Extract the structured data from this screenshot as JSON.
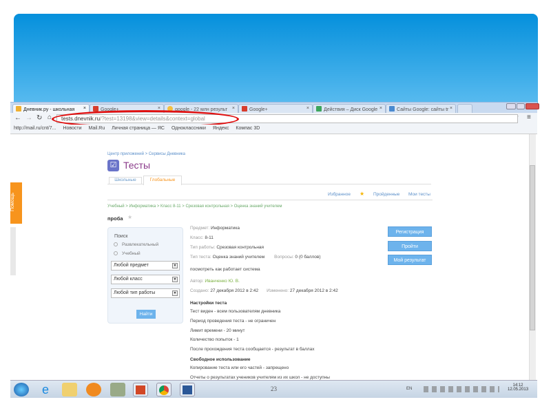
{
  "browser": {
    "tabs": [
      {
        "label": "Дневник.ру - школьная"
      },
      {
        "label": "Google+"
      },
      {
        "label": "google - 22 млн результ"
      },
      {
        "label": "Google+"
      },
      {
        "label": "Действия – Диск Google"
      },
      {
        "label": "Сайты Google: сайты tr"
      }
    ],
    "tab_close": "×",
    "url_host": "tests.dnevnik.ru",
    "url_path": "/?test=13198&view=details&context=global",
    "bookmarks": [
      "http://mail.ru/cnt/7...",
      "Новости",
      "Mail.Ru",
      "Личная страница — ЯС",
      "Одноклассники",
      "Яндекс",
      "Компас 3D"
    ]
  },
  "help_tab": "Помощь",
  "page": {
    "breadcrumb_top": "Центр приложений > Сервисы Дневника",
    "title": "Тесты",
    "tabs": [
      "Школьные",
      "Глобальные"
    ],
    "nav": {
      "favorites": "Избранное",
      "passed": "Пройденные",
      "my_tests": "Мои тесты"
    },
    "breadcrumb": "Учебный > Информатика > Класс 8-11 > Срезовая контрольная > Оценка знаний учителем",
    "test_name": "проба",
    "search": {
      "title": "Поиск",
      "radios": [
        "Развлекательный",
        "Учебный"
      ],
      "selects": [
        "Любой предмет",
        "Любой класс",
        "Любой тип работы"
      ],
      "button": "Найти"
    },
    "details": [
      {
        "label": "Предмет:",
        "value": "Информатика"
      },
      {
        "label": "Класс:",
        "value": "8-11"
      },
      {
        "label": "Тип работы:",
        "value": "Срезовая контрольная"
      }
    ],
    "test_type_label": "Тип теста:",
    "test_type": "Оценка знаний учителем",
    "questions_label": "Вопросы:",
    "questions": "0 (0 баллов)",
    "description": "посмотреть как работает система",
    "author_label": "Автор:",
    "author": "Иванченко Ю. В.",
    "created_label": "Создано:",
    "created": "27 декабря 2012 в 2:42",
    "modified_label": "Изменено:",
    "modified": "27 декабря 2012 в 2:42",
    "settings_title": "Настройки теста",
    "settings": [
      "Тест виден - всем пользователям дневника",
      "Период проведения теста - не ограничен",
      "Лимит времени - 20 минут",
      "Количество попыток - 1",
      "После прохождения теста сообщается - результат в баллах"
    ],
    "free_title": "Свободное использование",
    "free": [
      "Копирование теста или его частей - запрещено",
      "Отчеты о результатах учеников учителям из их школ - не доступны"
    ],
    "buttons": [
      "Регистрация",
      "Пройти",
      "Мой результат"
    ]
  },
  "slide_number": "23",
  "taskbar": {
    "lang": "EN",
    "time": "14:12",
    "date": "12.05.2013"
  },
  "colors": {
    "banner": "#0590dc",
    "button": "#6db3ec",
    "active_tab": "#f7941d",
    "oval": "#e01010"
  }
}
